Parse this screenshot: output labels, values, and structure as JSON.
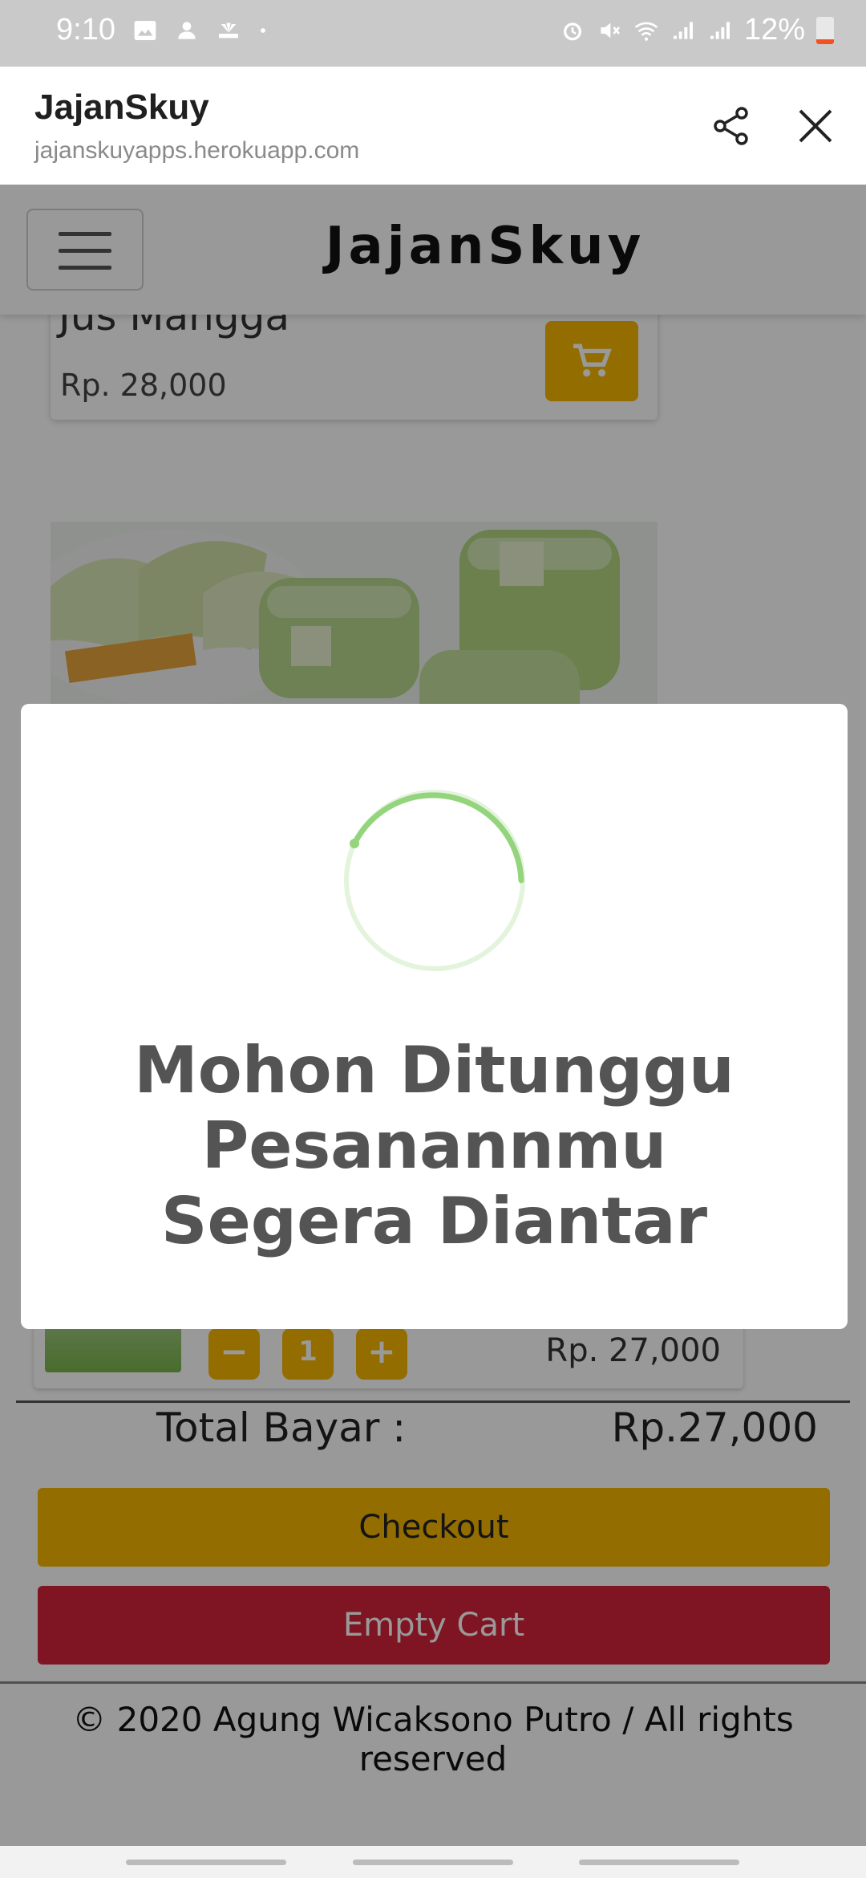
{
  "status_bar": {
    "time": "9:10",
    "battery": "12%",
    "icons": [
      "image-icon",
      "app-icon",
      "nbc-icon",
      "dot-icon",
      "alarm-icon",
      "mute-icon",
      "wifi-icon",
      "signal-icon",
      "signal-icon"
    ]
  },
  "browser": {
    "title": "JajanSkuy",
    "url": "jajanskuyapps.herokuapp.com",
    "icons": [
      "share-icon",
      "close-icon"
    ]
  },
  "site": {
    "brand": "JajanSkuy",
    "menu_icon": "hamburger-icon"
  },
  "product": {
    "name": "Jus Mangga",
    "price": "Rp. 28,000",
    "cart_icon": "cart-icon"
  },
  "cart": {
    "qty": "1",
    "minus": "−",
    "plus": "+",
    "price": "Rp. 27,000",
    "total_label": "Total Bayar :",
    "total_value": "Rp.27,000",
    "checkout": "Checkout",
    "empty": "Empty Cart"
  },
  "footer": {
    "text": "© 2020 Agung Wicaksono Putro / All rights reserved"
  },
  "modal": {
    "line1": "Mohon Ditunggu",
    "line2": "Pesanannmu",
    "line3": "Segera Diantar",
    "spinner_color": "#93d47d"
  },
  "colors": {
    "accent": "#f5b600",
    "danger": "#d4233a"
  }
}
